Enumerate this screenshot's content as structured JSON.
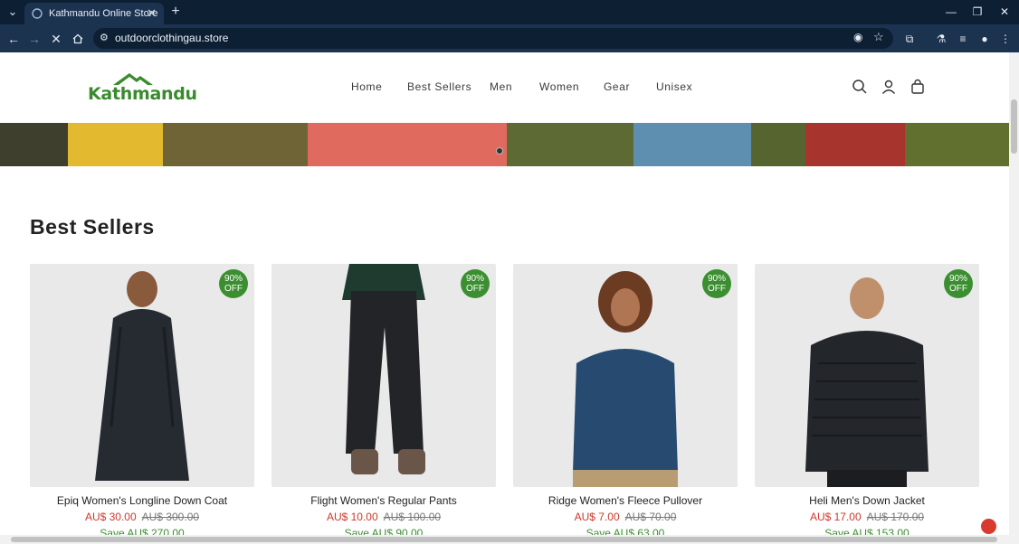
{
  "browser": {
    "tab_title": "Kathmandu Online Store",
    "url": "outdoorclothingau.store"
  },
  "site": {
    "logo_text": "Kathmandu",
    "brand_color": "#3a8a2e",
    "nav": [
      "Home",
      "Best Sellers",
      "Men",
      "Women",
      "Gear",
      "Unisex"
    ]
  },
  "section": {
    "title": "Best Sellers"
  },
  "products": [
    {
      "name": "Epiq Women's Longline Down Coat",
      "price": "AU$ 30.00",
      "compare": "AU$ 300.00",
      "save": "Save AU$ 270.00",
      "badge_top": "90%",
      "badge_bottom": "OFF"
    },
    {
      "name": "Flight Women's Regular Pants",
      "price": "AU$ 10.00",
      "compare": "AU$ 100.00",
      "save": "Save AU$ 90.00",
      "badge_top": "90%",
      "badge_bottom": "OFF"
    },
    {
      "name": "Ridge Women's Fleece Pullover",
      "price": "AU$ 7.00",
      "compare": "AU$ 70.00",
      "save": "Save AU$ 63.00",
      "badge_top": "90%",
      "badge_bottom": "OFF"
    },
    {
      "name": "Heli Men's Down Jacket",
      "price": "AU$ 17.00",
      "compare": "AU$ 170.00",
      "save": "Save AU$ 153.00",
      "badge_top": "90%",
      "badge_bottom": "OFF"
    }
  ],
  "colors": {
    "sale_price": "#d0362b",
    "badge": "#3c8f31"
  }
}
